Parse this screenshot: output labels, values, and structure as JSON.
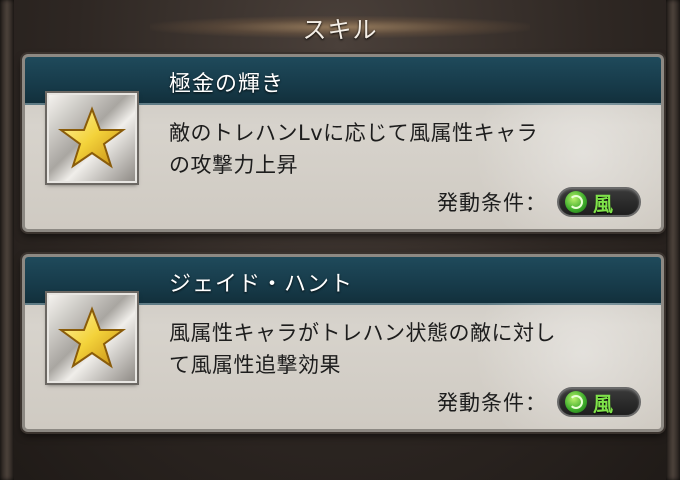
{
  "screen": {
    "title": "スキル"
  },
  "skills": [
    {
      "name": "極金の輝き",
      "icon": "star-icon",
      "description_line1": "敵のトレハンLvに応じて風属性キャラ",
      "description_line2": "の攻撃力上昇",
      "condition_label": "発動条件：",
      "condition_value": "風",
      "condition_icon": "wind-element-icon"
    },
    {
      "name": "ジェイド・ハント",
      "icon": "star-icon",
      "description_line1": "風属性キャラがトレハン状態の敵に対し",
      "description_line2": "て風属性追撃効果",
      "condition_label": "発動条件：",
      "condition_value": "風",
      "condition_icon": "wind-element-icon"
    }
  ],
  "colors": {
    "header_bg": "#173b4a",
    "card_bg": "#d7d3cc",
    "wind_green": "#7fe24a",
    "star_gold": "#f3d23a"
  }
}
